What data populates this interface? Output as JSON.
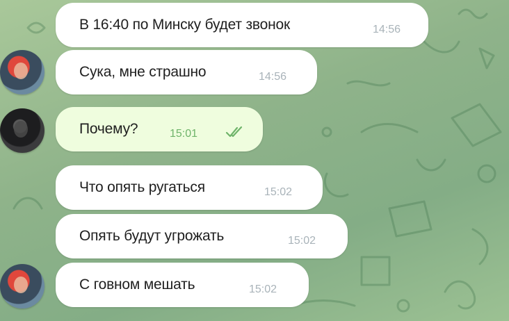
{
  "chat": {
    "messages": [
      {
        "text": "В 16:40 по Минску будет звонок",
        "time": "14:56",
        "side": "in"
      },
      {
        "text": "Сука, мне страшно",
        "time": "14:56",
        "side": "in"
      },
      {
        "text": "Почему?",
        "time": "15:01",
        "side": "out",
        "status": "read"
      },
      {
        "text": "Что опять ругаться",
        "time": "15:02",
        "side": "in"
      },
      {
        "text": "Опять будут угрожать",
        "time": "15:02",
        "side": "in"
      },
      {
        "text": "С говном мешать",
        "time": "15:02",
        "side": "in"
      }
    ]
  },
  "colors": {
    "incoming_bubble": "#ffffff",
    "outgoing_bubble": "#effdde",
    "read_check": "#6fb46a",
    "background": "#8fb38a"
  },
  "icons": {
    "read_status": "double-check-icon"
  }
}
